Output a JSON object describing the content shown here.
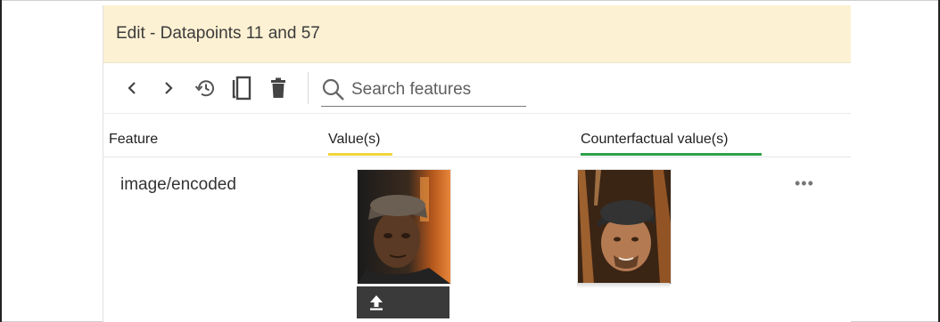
{
  "header": {
    "title": "Edit - Datapoints 11 and 57"
  },
  "toolbar": {
    "icons": [
      "chevron-left-icon",
      "chevron-right-icon",
      "history-icon",
      "copy-icon",
      "delete-icon",
      "search-icon"
    ],
    "search_placeholder": "Search features"
  },
  "columns": {
    "feature": "Feature",
    "values": "Value(s)",
    "counterfactual": "Counterfactual value(s)",
    "values_accent": "#f2d53c",
    "counterfactual_accent": "#2fa24b"
  },
  "rows": [
    {
      "feature": "image/encoded",
      "value_icon": "upload-icon",
      "more_label": "•••"
    }
  ],
  "colors": {
    "header_bg": "#fdf1d3",
    "upload_bar": "#3a3a3a"
  }
}
